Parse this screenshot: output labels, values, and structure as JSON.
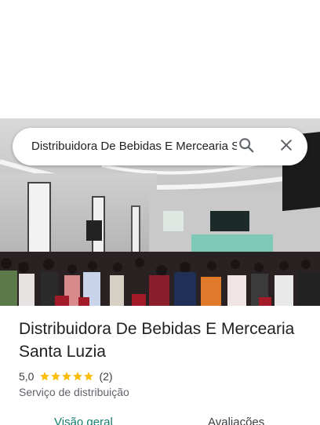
{
  "search": {
    "query": "Distribuidora De Bebidas E Mercearia Santa Luzia",
    "search_icon": "search-icon",
    "close_icon": "close-icon"
  },
  "place": {
    "name": "Distribuidora De Bebidas E Mercearia Santa Luzia",
    "rating": "5,0",
    "review_count": "(2)",
    "stars": 5,
    "star_color": "#fbbc04",
    "category": "Serviço de distribuição"
  },
  "tabs": [
    {
      "label": "Visão geral",
      "selected": true
    },
    {
      "label": "Avaliações",
      "selected": false
    }
  ],
  "colors": {
    "accent": "#137e6e"
  }
}
